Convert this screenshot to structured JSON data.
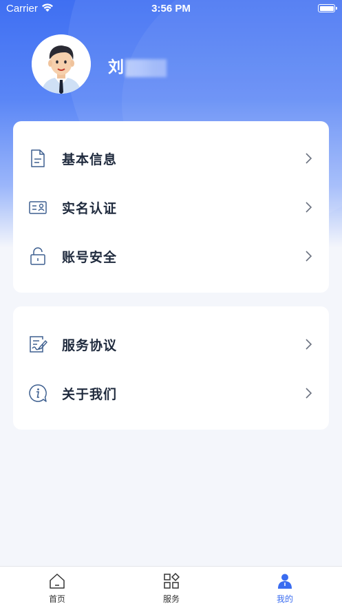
{
  "status_bar": {
    "carrier": "Carrier",
    "time": "3:56 PM"
  },
  "profile": {
    "name": "刘"
  },
  "menu_group_1": [
    {
      "label": "基本信息",
      "icon": "document-icon"
    },
    {
      "label": "实名认证",
      "icon": "id-card-icon"
    },
    {
      "label": "账号安全",
      "icon": "lock-icon"
    }
  ],
  "menu_group_2": [
    {
      "label": "服务协议",
      "icon": "agreement-icon"
    },
    {
      "label": "关于我们",
      "icon": "info-icon"
    }
  ],
  "tabbar": {
    "items": [
      {
        "label": "首页",
        "icon": "home-icon"
      },
      {
        "label": "服务",
        "icon": "services-grid-icon"
      },
      {
        "label": "我的",
        "icon": "user-icon"
      }
    ],
    "active_index": 2
  },
  "colors": {
    "accent": "#3a6cf0",
    "icon": "#3d5f8f",
    "text": "#1f2a3d"
  }
}
